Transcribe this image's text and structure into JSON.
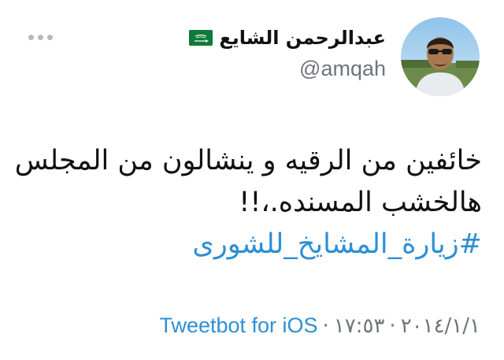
{
  "tweet": {
    "author": {
      "display_name": "عبدالرحمن الشايع",
      "handle": "@amqah",
      "flag_icon": "saudi-flag-icon"
    },
    "text_lines": [
      "خائفين من الرقيه و ينشالون من المجلس",
      "هالخشب المسنده.،!!"
    ],
    "hashtag": "#زيارة_المشايخ_للشورى",
    "meta": {
      "date": "٢٠١٤/١/١",
      "separator": "·",
      "time": "١٧:٥٣",
      "source": "Tweetbot for iOS"
    },
    "menu_icon": "more-horizontal-icon"
  },
  "colors": {
    "link": "#2d8fd5",
    "text": "#111111",
    "secondary": "#6e7479",
    "flag_green": "#0f7a3a"
  }
}
